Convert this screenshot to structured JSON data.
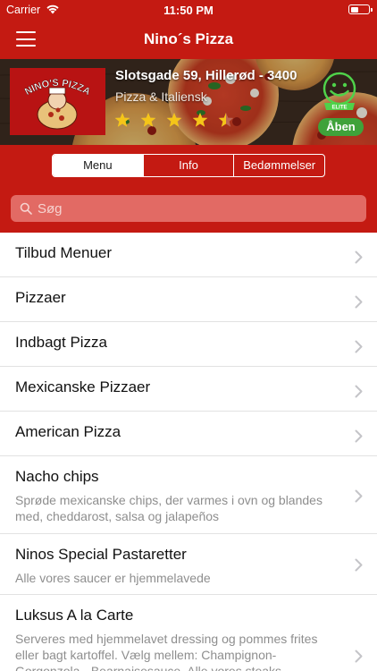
{
  "status_bar": {
    "carrier": "Carrier",
    "time": "11:50 PM",
    "battery_level": 0.45
  },
  "nav": {
    "title": "Nino´s Pizza",
    "menu_icon": "hamburger-icon"
  },
  "restaurant": {
    "address": "Slotsgade 59, Hillerød - 3400",
    "category": "Pizza & Italiensk",
    "rating": 4.5,
    "rating_max": 5,
    "smiley_label": "ELITE",
    "open_status": "Åben",
    "logo_text": "NINO'S PIZZA"
  },
  "tabs": [
    {
      "label": "Menu",
      "active": true
    },
    {
      "label": "Info",
      "active": false
    },
    {
      "label": "Bedømmelser",
      "active": false
    }
  ],
  "search": {
    "placeholder": "Søg",
    "value": ""
  },
  "menu_items": [
    {
      "title": "Tilbud Menuer",
      "subtitle": ""
    },
    {
      "title": "Pizzaer",
      "subtitle": ""
    },
    {
      "title": "Indbagt Pizza",
      "subtitle": ""
    },
    {
      "title": "Mexicanske Pizzaer",
      "subtitle": ""
    },
    {
      "title": "American Pizza",
      "subtitle": ""
    },
    {
      "title": "Nacho chips",
      "subtitle": "Sprøde mexicanske chips, der varmes i ovn og blandes med, cheddarost, salsa og jalapeños"
    },
    {
      "title": "Ninos Special Pastaretter",
      "subtitle": "Alle vores saucer er hjemmelavede"
    },
    {
      "title": "Luksus A la Carte",
      "subtitle": "Serveres med hjemmelavet dressing og pommes frites eller bagt kartoffel. Vælg mellem: Champignon-Gorgonzola-, Bearnaisesauce. Alle vores steaks"
    }
  ],
  "colors": {
    "brand_red": "#c41a12",
    "open_green": "#3fa23a",
    "star_yellow": "#f5c518",
    "search_bg": "#e26a64"
  }
}
